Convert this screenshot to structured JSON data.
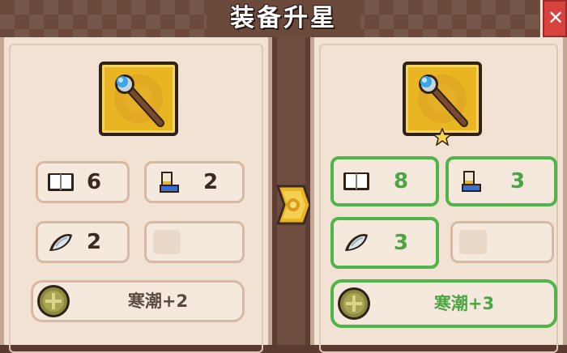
{
  "window": {
    "title": "装备升星"
  },
  "colors": {
    "accent_green": "#4fb548",
    "frame_brown": "#6b4a3b",
    "panel_bg": "#f1e2d4",
    "item_gold": "#e9b523",
    "close_red": "#d8423c"
  },
  "current": {
    "item_icon": "magic-staff-icon",
    "stars": 0,
    "stats": [
      {
        "icon": "book-icon",
        "value": "6"
      },
      {
        "icon": "boot-icon",
        "value": "2"
      },
      {
        "icon": "feather-icon",
        "value": "2"
      },
      {
        "icon": "empty-slot",
        "value": ""
      }
    ],
    "skill": {
      "icon": "skill-orb-icon",
      "label": "寒潮+2"
    }
  },
  "upgraded": {
    "item_icon": "magic-staff-icon",
    "stars": 1,
    "stats": [
      {
        "icon": "book-icon",
        "value": "8"
      },
      {
        "icon": "boot-icon",
        "value": "3"
      },
      {
        "icon": "feather-icon",
        "value": "3"
      },
      {
        "icon": "empty-slot",
        "value": ""
      }
    ],
    "skill": {
      "icon": "skill-orb-icon",
      "label": "寒潮+3"
    }
  }
}
